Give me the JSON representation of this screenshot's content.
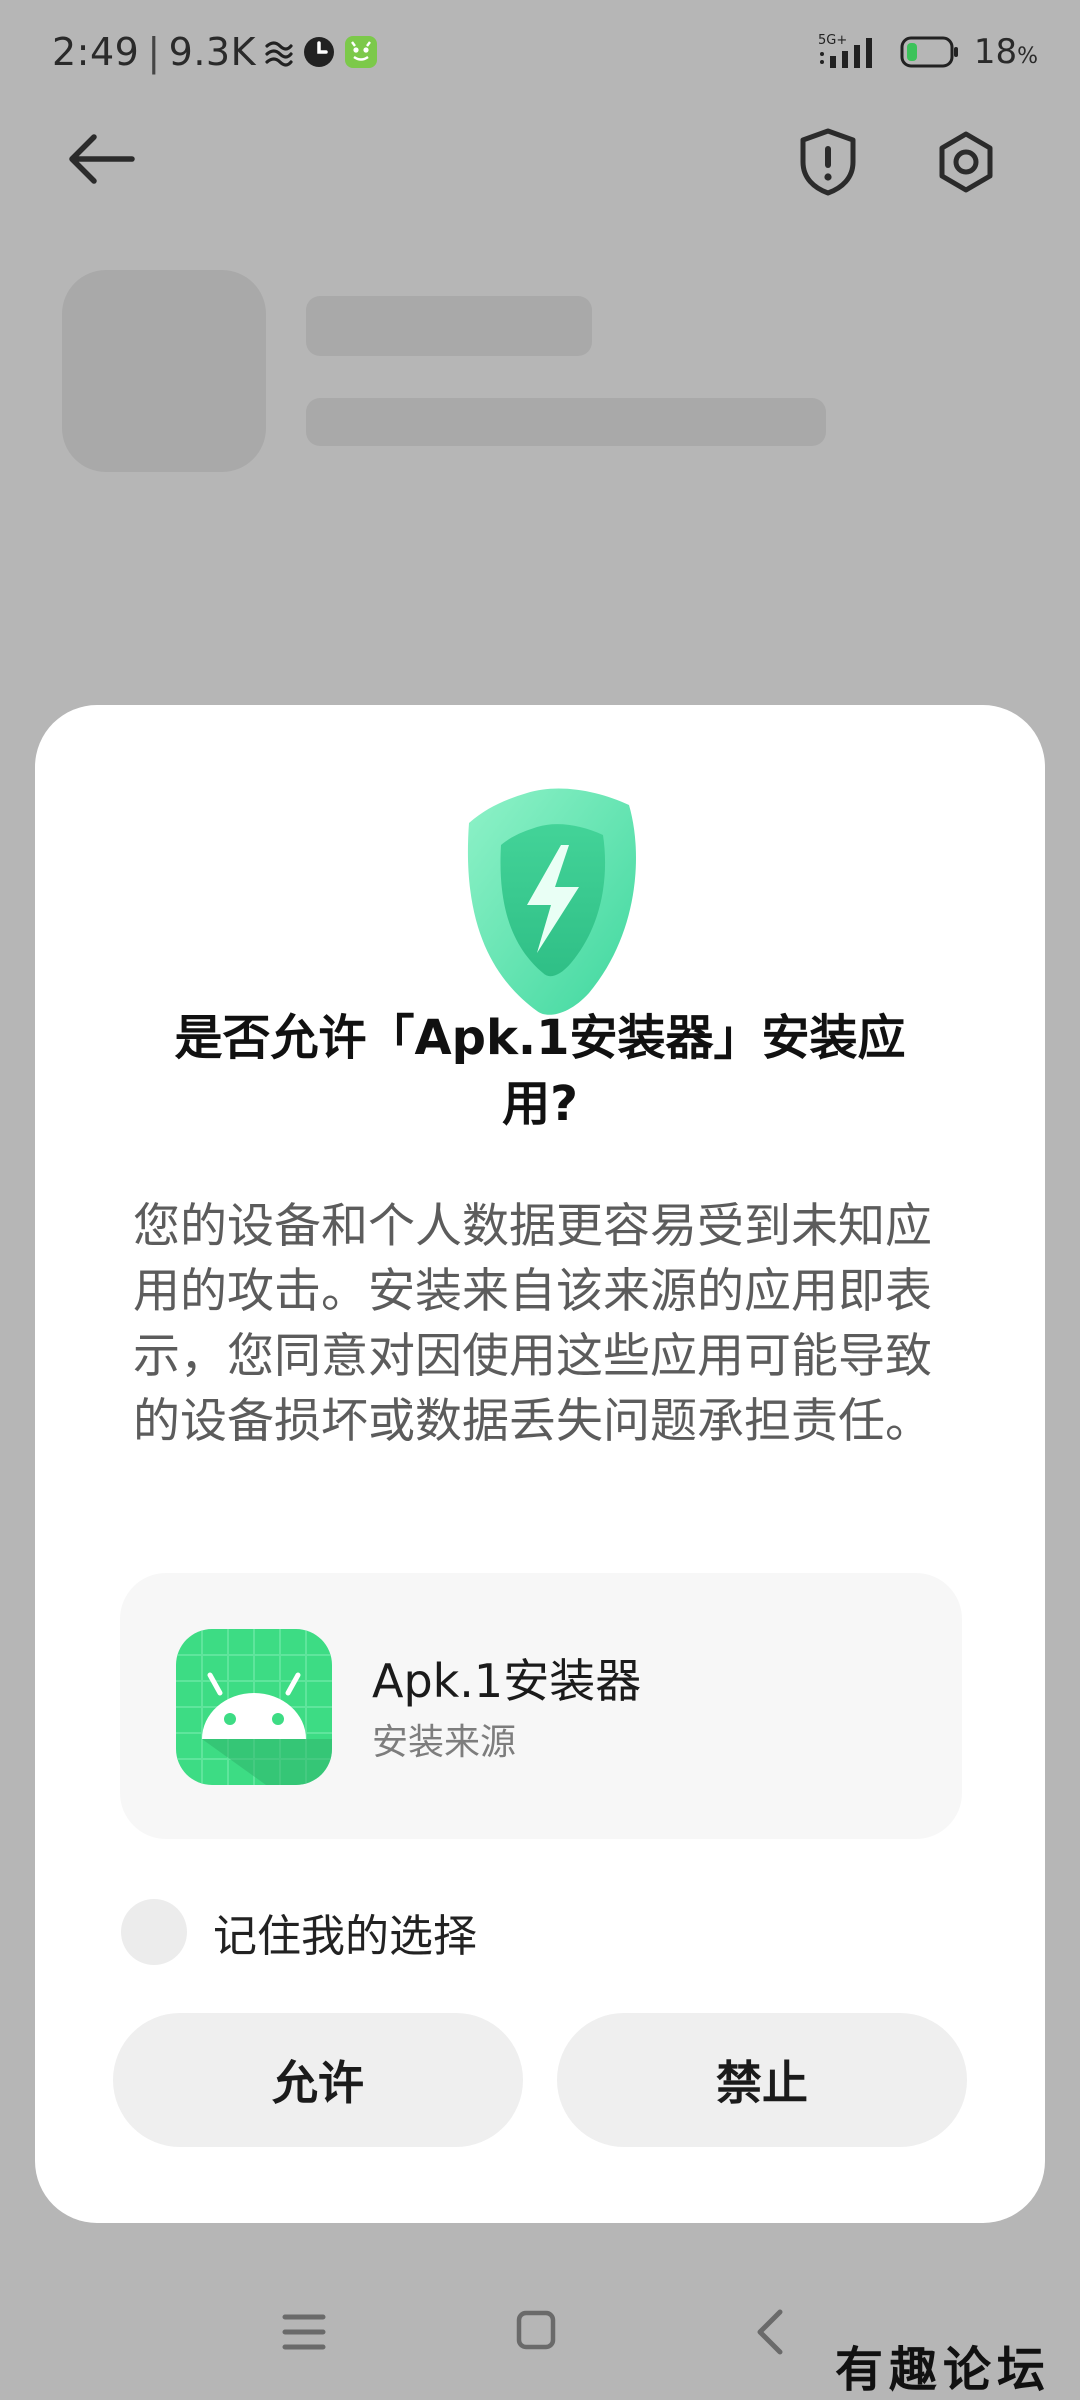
{
  "status_bar": {
    "time": "2:49",
    "separator": "|",
    "net_speed": "9.3K",
    "network": "5G+",
    "battery_percent": "18",
    "battery_unit": "%",
    "icons": [
      "wave-icon",
      "clock-icon",
      "app-notification-icon",
      "signal-icon",
      "battery-icon"
    ]
  },
  "topbar": {
    "icons": [
      "back-arrow-icon",
      "shield-alert-icon",
      "settings-icon"
    ]
  },
  "dialog": {
    "title": "是否允许「Apk.1安装器」安装应用?",
    "message": "您的设备和个人数据更容易受到未知应用的攻击。安装来自该来源的应用即表示，您同意对因使用这些应用可能导致的设备损坏或数据丢失问题承担责任。",
    "source": {
      "app_name": "Apk.1安装器",
      "subtitle": "安装来源",
      "icon": "android-robot-icon"
    },
    "remember_label": "记住我的选择",
    "remember_checked": false,
    "allow_label": "允许",
    "deny_label": "禁止"
  },
  "nav_bar": {
    "icons": [
      "menu-icon",
      "home-icon",
      "back-icon"
    ]
  },
  "watermark": "有趣论坛",
  "colors": {
    "scrim": "#b6b6b6",
    "dialog_bg": "#ffffff",
    "button_bg": "#efefef",
    "shield_green": "#5fe3b0",
    "app_icon_green": "#3ddc84",
    "battery_fill": "#3cc35a"
  }
}
